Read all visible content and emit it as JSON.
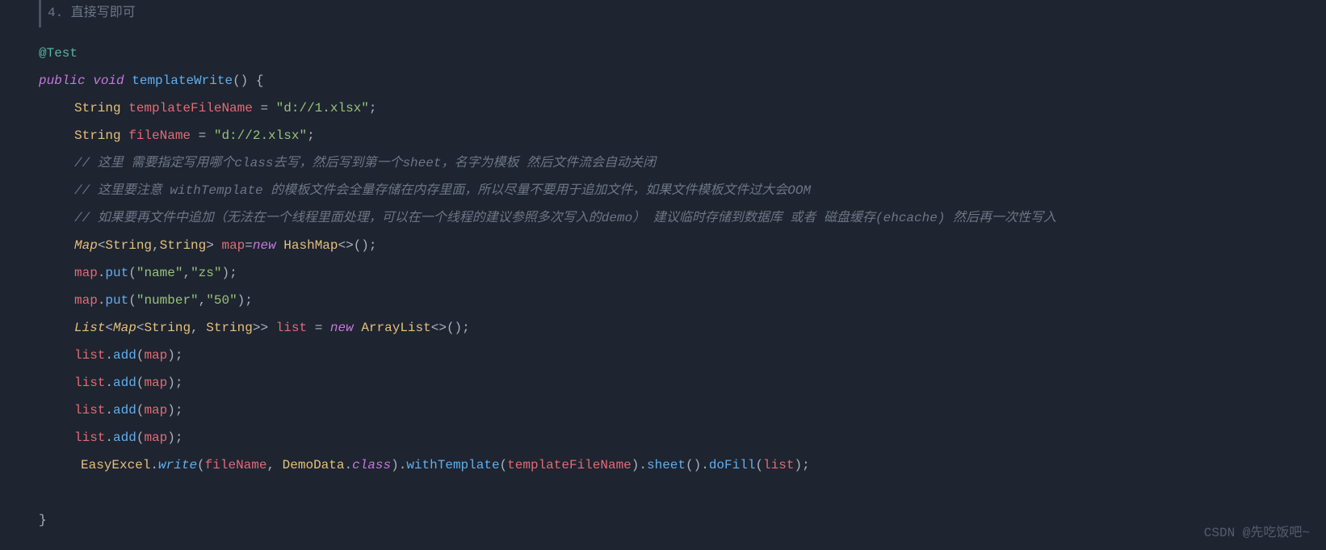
{
  "header_comment": "4. 直接写即可",
  "annotation": "@Test",
  "method_sig": {
    "public": "public",
    "void": "void",
    "name": "templateWrite",
    "parens": "()",
    "brace": " {"
  },
  "line_template": {
    "type": "String",
    "var": "templateFileName",
    "eq": " = ",
    "val": "\"d://1.xlsx\"",
    "semi": ";"
  },
  "line_filename": {
    "type": "String",
    "var": "fileName",
    "eq": " = ",
    "val": "\"d://2.xlsx\"",
    "semi": ";"
  },
  "comment1_a": "// 这里 需要指定写用哪个",
  "comment1_b": "class",
  "comment1_c": "去写，然后写到第一个",
  "comment1_d": "sheet",
  "comment1_e": "，名字为模板 然后文件流会自动关闭",
  "comment2_a": "// 这里要注意 ",
  "comment2_b": "withTemplate",
  "comment2_c": " 的模板文件会全量存储在内存里面，所以尽量不要用于追加文件，如果文件模板文件过大会OOM",
  "comment3_a": "// 如果要再文件中追加（无法在一个线程里面处理，可以在一个线程的建议参照多次写入的demo） 建议临时存储到数据库 或者 磁盘缓存(ehcache) 然后再一次性写入",
  "map_decl": {
    "type": "Map",
    "generic_open": "<",
    "g1": "String",
    "comma": ",",
    "g2": "String",
    "generic_close": ">",
    "var": " map",
    "eq": "=",
    "new": "new",
    "class": " HashMap",
    "diamond": "<>()",
    "semi": ";"
  },
  "put1": {
    "obj": "map",
    "dot": ".",
    "method": "put",
    "open": "(",
    "k": "\"name\"",
    "comma": ",",
    "v": "\"zs\"",
    "close": ")",
    "semi": ";"
  },
  "put2": {
    "obj": "map",
    "dot": ".",
    "method": "put",
    "open": "(",
    "k": "\"number\"",
    "comma": ",",
    "v": "\"50\"",
    "close": ")",
    "semi": ";"
  },
  "list_decl": {
    "type": "List",
    "lt": "<",
    "inner_type": "Map",
    "ilt": "<",
    "ig1": "String",
    "icomma": ", ",
    "ig2": "String",
    "igt": ">",
    "gt": ">",
    "var": " list",
    "eq": " = ",
    "new": "new",
    "class": " ArrayList",
    "diamond": "<>()",
    "semi": ";"
  },
  "add": {
    "obj": "list",
    "dot": ".",
    "method": "add",
    "open": "(",
    "arg": "map",
    "close": ")",
    "semi": ";"
  },
  "easy": {
    "cls": "EasyExcel",
    "dot": ".",
    "write": "write",
    "open": "(",
    "arg1": "fileName",
    "comma": ", ",
    "demo": "DemoData",
    "dotclass": ".",
    "classkw": "class",
    "close": ")",
    "dot2": ".",
    "withTemplate": "withTemplate",
    "open2": "(",
    "arg2": "templateFileName",
    "close2": ")",
    "dot3": ".",
    "sheet": "sheet",
    "parens3": "()",
    "dot4": ".",
    "doFill": "doFill",
    "open4": "(",
    "arg4": "list",
    "close4": ")",
    "semi": ";"
  },
  "close_brace": "}",
  "watermark": "CSDN @先吃饭吧~"
}
